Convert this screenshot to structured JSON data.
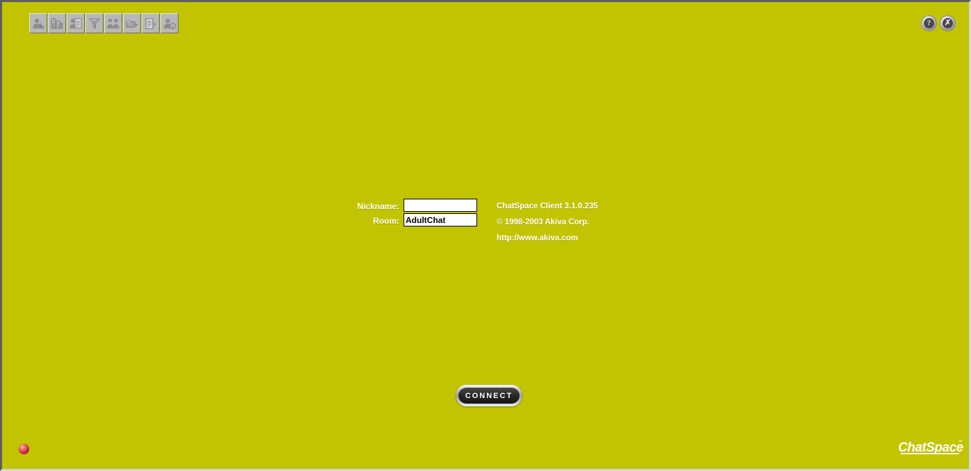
{
  "window": {
    "background_color": "#c2c400",
    "app_name": "ChatSpace Client"
  },
  "toolbar": {
    "items": [
      {
        "name": "user-profile-icon",
        "tooltip": "Profile"
      },
      {
        "name": "buildings-icon",
        "tooltip": "Rooms"
      },
      {
        "name": "notepad-person-icon",
        "tooltip": "Member List"
      },
      {
        "name": "filter-funnel-icon",
        "tooltip": "Filter"
      },
      {
        "name": "two-people-icon",
        "tooltip": "Friends"
      },
      {
        "name": "folder-arrow-icon",
        "tooltip": "Folders"
      },
      {
        "name": "document-arrow-icon",
        "tooltip": "Logs"
      },
      {
        "name": "user-help-icon",
        "tooltip": "User Help"
      }
    ]
  },
  "topright": {
    "buttons": [
      {
        "name": "help-button",
        "glyph": "?"
      },
      {
        "name": "close-button",
        "glyph": "✗"
      }
    ]
  },
  "login": {
    "nickname": {
      "label": "Nickname:",
      "value": "",
      "placeholder": ""
    },
    "room": {
      "label": "Room:",
      "value": "AdultChat",
      "placeholder": ""
    }
  },
  "info": {
    "version": "ChatSpace Client 3.1.0.235",
    "copyright": "© 1998-2003 Akiva Corp.",
    "website": "http://www.akiva.com"
  },
  "connect": {
    "label": "CONNECT"
  },
  "status": {
    "led_name": "connection-status-led",
    "led_color": "#c62230"
  },
  "brand": {
    "text": "ChatSpace",
    "trademark": "™"
  }
}
